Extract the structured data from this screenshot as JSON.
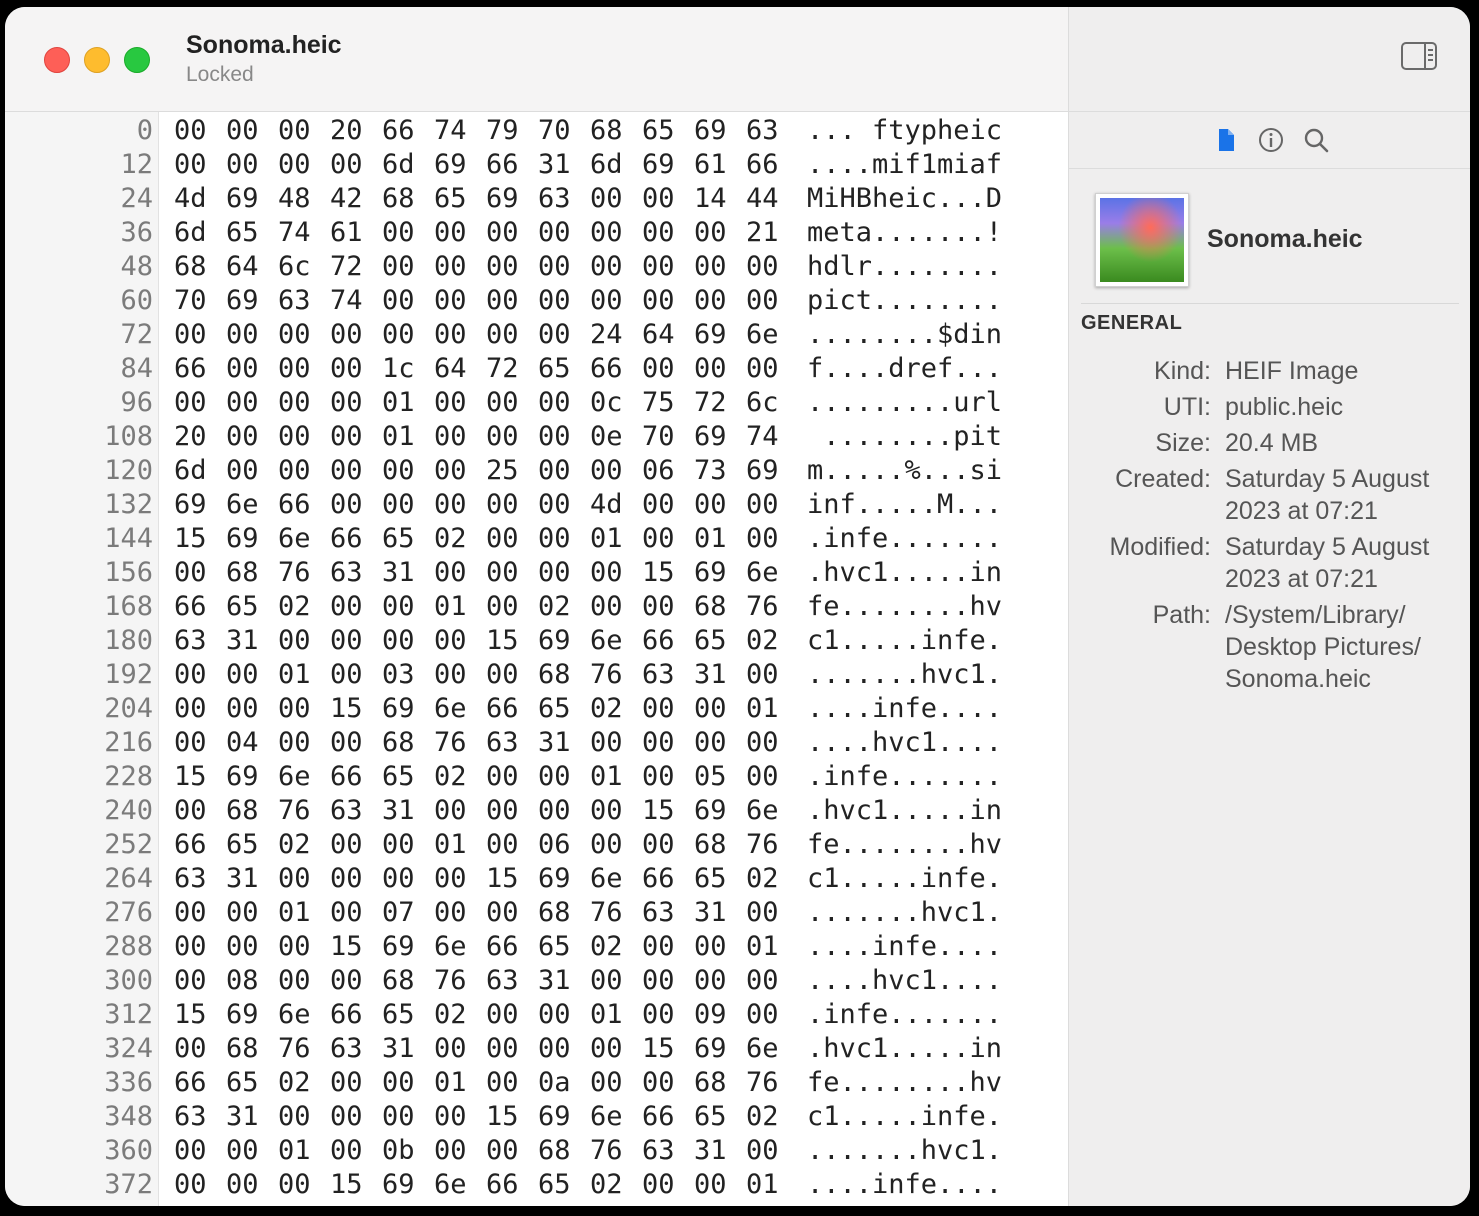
{
  "window": {
    "title": "Sonoma.heic",
    "subtitle": "Locked"
  },
  "hex": {
    "rows": [
      {
        "offset": "0",
        "bytes": [
          "00",
          "00",
          "00",
          "20",
          "66",
          "74",
          "79",
          "70",
          "68",
          "65",
          "69",
          "63"
        ],
        "ascii": "... ftypheic"
      },
      {
        "offset": "12",
        "bytes": [
          "00",
          "00",
          "00",
          "00",
          "6d",
          "69",
          "66",
          "31",
          "6d",
          "69",
          "61",
          "66"
        ],
        "ascii": "....mif1miaf"
      },
      {
        "offset": "24",
        "bytes": [
          "4d",
          "69",
          "48",
          "42",
          "68",
          "65",
          "69",
          "63",
          "00",
          "00",
          "14",
          "44"
        ],
        "ascii": "MiHBheic...D"
      },
      {
        "offset": "36",
        "bytes": [
          "6d",
          "65",
          "74",
          "61",
          "00",
          "00",
          "00",
          "00",
          "00",
          "00",
          "00",
          "21"
        ],
        "ascii": "meta.......!"
      },
      {
        "offset": "48",
        "bytes": [
          "68",
          "64",
          "6c",
          "72",
          "00",
          "00",
          "00",
          "00",
          "00",
          "00",
          "00",
          "00"
        ],
        "ascii": "hdlr........"
      },
      {
        "offset": "60",
        "bytes": [
          "70",
          "69",
          "63",
          "74",
          "00",
          "00",
          "00",
          "00",
          "00",
          "00",
          "00",
          "00"
        ],
        "ascii": "pict........"
      },
      {
        "offset": "72",
        "bytes": [
          "00",
          "00",
          "00",
          "00",
          "00",
          "00",
          "00",
          "00",
          "24",
          "64",
          "69",
          "6e"
        ],
        "ascii": "........$din"
      },
      {
        "offset": "84",
        "bytes": [
          "66",
          "00",
          "00",
          "00",
          "1c",
          "64",
          "72",
          "65",
          "66",
          "00",
          "00",
          "00"
        ],
        "ascii": "f....dref..."
      },
      {
        "offset": "96",
        "bytes": [
          "00",
          "00",
          "00",
          "00",
          "01",
          "00",
          "00",
          "00",
          "0c",
          "75",
          "72",
          "6c"
        ],
        "ascii": ".........url"
      },
      {
        "offset": "108",
        "bytes": [
          "20",
          "00",
          "00",
          "00",
          "01",
          "00",
          "00",
          "00",
          "0e",
          "70",
          "69",
          "74"
        ],
        "ascii": " ........pit"
      },
      {
        "offset": "120",
        "bytes": [
          "6d",
          "00",
          "00",
          "00",
          "00",
          "00",
          "25",
          "00",
          "00",
          "06",
          "73",
          "69"
        ],
        "ascii": "m.....%...si"
      },
      {
        "offset": "132",
        "bytes": [
          "69",
          "6e",
          "66",
          "00",
          "00",
          "00",
          "00",
          "00",
          "4d",
          "00",
          "00",
          "00"
        ],
        "ascii": "inf.....M..."
      },
      {
        "offset": "144",
        "bytes": [
          "15",
          "69",
          "6e",
          "66",
          "65",
          "02",
          "00",
          "00",
          "01",
          "00",
          "01",
          "00"
        ],
        "ascii": ".infe......."
      },
      {
        "offset": "156",
        "bytes": [
          "00",
          "68",
          "76",
          "63",
          "31",
          "00",
          "00",
          "00",
          "00",
          "15",
          "69",
          "6e"
        ],
        "ascii": ".hvc1.....in"
      },
      {
        "offset": "168",
        "bytes": [
          "66",
          "65",
          "02",
          "00",
          "00",
          "01",
          "00",
          "02",
          "00",
          "00",
          "68",
          "76"
        ],
        "ascii": "fe........hv"
      },
      {
        "offset": "180",
        "bytes": [
          "63",
          "31",
          "00",
          "00",
          "00",
          "00",
          "15",
          "69",
          "6e",
          "66",
          "65",
          "02"
        ],
        "ascii": "c1.....infe."
      },
      {
        "offset": "192",
        "bytes": [
          "00",
          "00",
          "01",
          "00",
          "03",
          "00",
          "00",
          "68",
          "76",
          "63",
          "31",
          "00"
        ],
        "ascii": ".......hvc1."
      },
      {
        "offset": "204",
        "bytes": [
          "00",
          "00",
          "00",
          "15",
          "69",
          "6e",
          "66",
          "65",
          "02",
          "00",
          "00",
          "01"
        ],
        "ascii": "....infe...."
      },
      {
        "offset": "216",
        "bytes": [
          "00",
          "04",
          "00",
          "00",
          "68",
          "76",
          "63",
          "31",
          "00",
          "00",
          "00",
          "00"
        ],
        "ascii": "....hvc1...."
      },
      {
        "offset": "228",
        "bytes": [
          "15",
          "69",
          "6e",
          "66",
          "65",
          "02",
          "00",
          "00",
          "01",
          "00",
          "05",
          "00"
        ],
        "ascii": ".infe......."
      },
      {
        "offset": "240",
        "bytes": [
          "00",
          "68",
          "76",
          "63",
          "31",
          "00",
          "00",
          "00",
          "00",
          "15",
          "69",
          "6e"
        ],
        "ascii": ".hvc1.....in"
      },
      {
        "offset": "252",
        "bytes": [
          "66",
          "65",
          "02",
          "00",
          "00",
          "01",
          "00",
          "06",
          "00",
          "00",
          "68",
          "76"
        ],
        "ascii": "fe........hv"
      },
      {
        "offset": "264",
        "bytes": [
          "63",
          "31",
          "00",
          "00",
          "00",
          "00",
          "15",
          "69",
          "6e",
          "66",
          "65",
          "02"
        ],
        "ascii": "c1.....infe."
      },
      {
        "offset": "276",
        "bytes": [
          "00",
          "00",
          "01",
          "00",
          "07",
          "00",
          "00",
          "68",
          "76",
          "63",
          "31",
          "00"
        ],
        "ascii": ".......hvc1."
      },
      {
        "offset": "288",
        "bytes": [
          "00",
          "00",
          "00",
          "15",
          "69",
          "6e",
          "66",
          "65",
          "02",
          "00",
          "00",
          "01"
        ],
        "ascii": "....infe...."
      },
      {
        "offset": "300",
        "bytes": [
          "00",
          "08",
          "00",
          "00",
          "68",
          "76",
          "63",
          "31",
          "00",
          "00",
          "00",
          "00"
        ],
        "ascii": "....hvc1...."
      },
      {
        "offset": "312",
        "bytes": [
          "15",
          "69",
          "6e",
          "66",
          "65",
          "02",
          "00",
          "00",
          "01",
          "00",
          "09",
          "00"
        ],
        "ascii": ".infe......."
      },
      {
        "offset": "324",
        "bytes": [
          "00",
          "68",
          "76",
          "63",
          "31",
          "00",
          "00",
          "00",
          "00",
          "15",
          "69",
          "6e"
        ],
        "ascii": ".hvc1.....in"
      },
      {
        "offset": "336",
        "bytes": [
          "66",
          "65",
          "02",
          "00",
          "00",
          "01",
          "00",
          "0a",
          "00",
          "00",
          "68",
          "76"
        ],
        "ascii": "fe........hv"
      },
      {
        "offset": "348",
        "bytes": [
          "63",
          "31",
          "00",
          "00",
          "00",
          "00",
          "15",
          "69",
          "6e",
          "66",
          "65",
          "02"
        ],
        "ascii": "c1.....infe."
      },
      {
        "offset": "360",
        "bytes": [
          "00",
          "00",
          "01",
          "00",
          "0b",
          "00",
          "00",
          "68",
          "76",
          "63",
          "31",
          "00"
        ],
        "ascii": ".......hvc1."
      },
      {
        "offset": "372",
        "bytes": [
          "00",
          "00",
          "00",
          "15",
          "69",
          "6e",
          "66",
          "65",
          "02",
          "00",
          "00",
          "01"
        ],
        "ascii": "....infe...."
      }
    ]
  },
  "inspector": {
    "tabs": [
      {
        "icon": "file-icon",
        "active": true
      },
      {
        "icon": "info-icon",
        "active": false
      },
      {
        "icon": "search-icon",
        "active": false
      }
    ],
    "file_name": "Sonoma.heic",
    "section_title": "GENERAL",
    "properties": [
      {
        "label": "Kind:",
        "value": "HEIF Image"
      },
      {
        "label": "UTI:",
        "value": "public.heic"
      },
      {
        "label": "Size:",
        "value": "20.4 MB"
      },
      {
        "label": "Created:",
        "value": "Saturday 5 August 2023 at 07:21"
      },
      {
        "label": "Modified:",
        "value": "Saturday 5 August 2023 at 07:21"
      },
      {
        "label": "Path:",
        "value": "/System/Library/ Desktop Pictures/ Sonoma.heic"
      }
    ]
  },
  "colors": {
    "accent": "#1a73e8",
    "close": "#fe5f57",
    "minimize": "#febc2e",
    "zoom": "#28c840"
  }
}
